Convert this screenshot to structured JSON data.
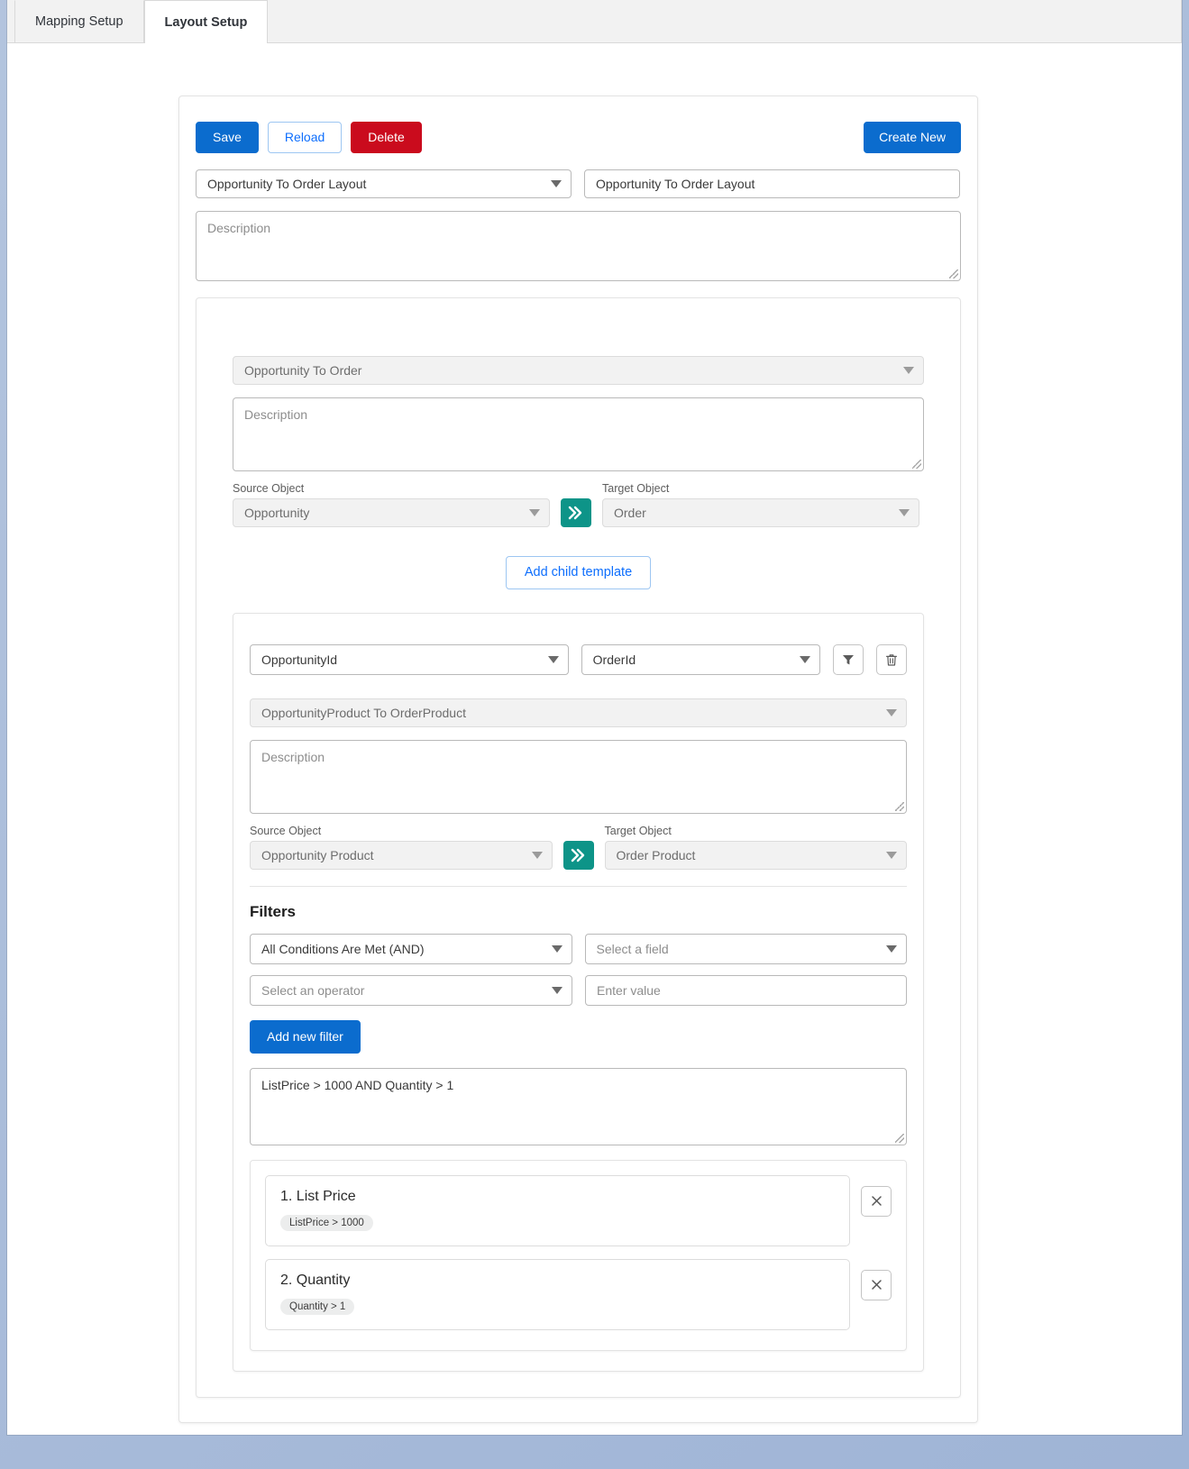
{
  "tabs": [
    {
      "label": "Mapping Setup",
      "active": false
    },
    {
      "label": "Layout Setup",
      "active": true
    }
  ],
  "toolbar": {
    "save_label": "Save",
    "reload_label": "Reload",
    "delete_label": "Delete",
    "create_new_label": "Create New"
  },
  "layout": {
    "select_value": "Opportunity To Order Layout",
    "name_value": "Opportunity To Order Layout",
    "description_placeholder": "Description"
  },
  "parent_template": {
    "name": "Opportunity To Order",
    "description_placeholder": "Description",
    "source_object_label": "Source Object",
    "source_object_value": "Opportunity",
    "target_object_label": "Target Object",
    "target_object_value": "Order",
    "transfer_icon": "double-chevron-right-icon",
    "add_child_label": "Add child template"
  },
  "mapping_row": {
    "source_field": "OpportunityId",
    "target_field": "OrderId",
    "filter_icon": "funnel-icon",
    "delete_icon": "trash-icon"
  },
  "child_template": {
    "name": "OpportunityProduct To OrderProduct",
    "description_placeholder": "Description",
    "source_object_label": "Source Object",
    "source_object_value": "Opportunity Product",
    "target_object_label": "Target Object",
    "target_object_value": "Order Product",
    "transfer_icon": "double-chevron-right-icon"
  },
  "filters": {
    "heading": "Filters",
    "logic_value": "All Conditions Are Met (AND)",
    "field_placeholder": "Select a field",
    "operator_placeholder": "Select an operator",
    "value_placeholder": "Enter value",
    "add_filter_label": "Add new filter",
    "expression": "ListPrice > 1000 AND  Quantity > 1",
    "items": [
      {
        "title": "1. List Price",
        "chip": "ListPrice > 1000",
        "remove_icon": "close-icon"
      },
      {
        "title": "2. Quantity",
        "chip": "Quantity > 1",
        "remove_icon": "close-icon"
      }
    ]
  },
  "colors": {
    "primary": "#0b6cce",
    "danger": "#ca0b1d",
    "teal": "#0d9488",
    "desktop": "#adbfdd"
  }
}
